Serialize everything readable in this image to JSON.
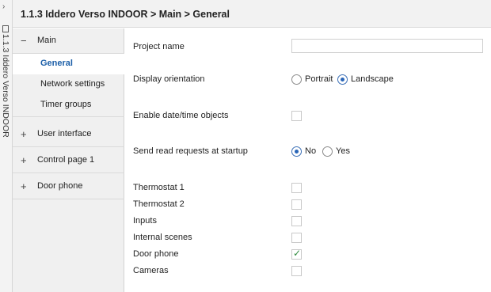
{
  "side_strip": {
    "label": "1.1.3 Iddero Verso INDOOR",
    "chevron": "›"
  },
  "titlebar": {
    "title": "1.1.3 Iddero Verso INDOOR > Main > General"
  },
  "sidebar": {
    "groups": [
      {
        "sign": "−",
        "label": "Main",
        "children": [
          {
            "label": "General",
            "active": true
          },
          {
            "label": "Network settings"
          },
          {
            "label": "Timer groups"
          }
        ]
      },
      {
        "sign": "+",
        "label": "User interface"
      },
      {
        "sign": "+",
        "label": "Control page 1"
      },
      {
        "sign": "+",
        "label": "Door phone"
      }
    ]
  },
  "main": {
    "project_name": {
      "label": "Project name",
      "value": ""
    },
    "display_orientation": {
      "label": "Display orientation",
      "options": [
        "Portrait",
        "Landscape"
      ],
      "selected": "Landscape"
    },
    "enable_datetime": {
      "label": "Enable date/time objects",
      "checked": false
    },
    "read_requests": {
      "label": "Send read requests at startup",
      "options": [
        "No",
        "Yes"
      ],
      "selected": "No"
    },
    "checks": [
      {
        "label": "Thermostat 1",
        "checked": false
      },
      {
        "label": "Thermostat 2",
        "checked": false
      },
      {
        "label": "Inputs",
        "checked": false
      },
      {
        "label": "Internal scenes",
        "checked": false
      },
      {
        "label": "Door phone",
        "checked": true
      },
      {
        "label": "Cameras",
        "checked": false
      }
    ]
  },
  "colors": {
    "accent": "#1c5fa8",
    "check": "#2e8b3e",
    "sidebar_bg": "#f0f0f0"
  }
}
